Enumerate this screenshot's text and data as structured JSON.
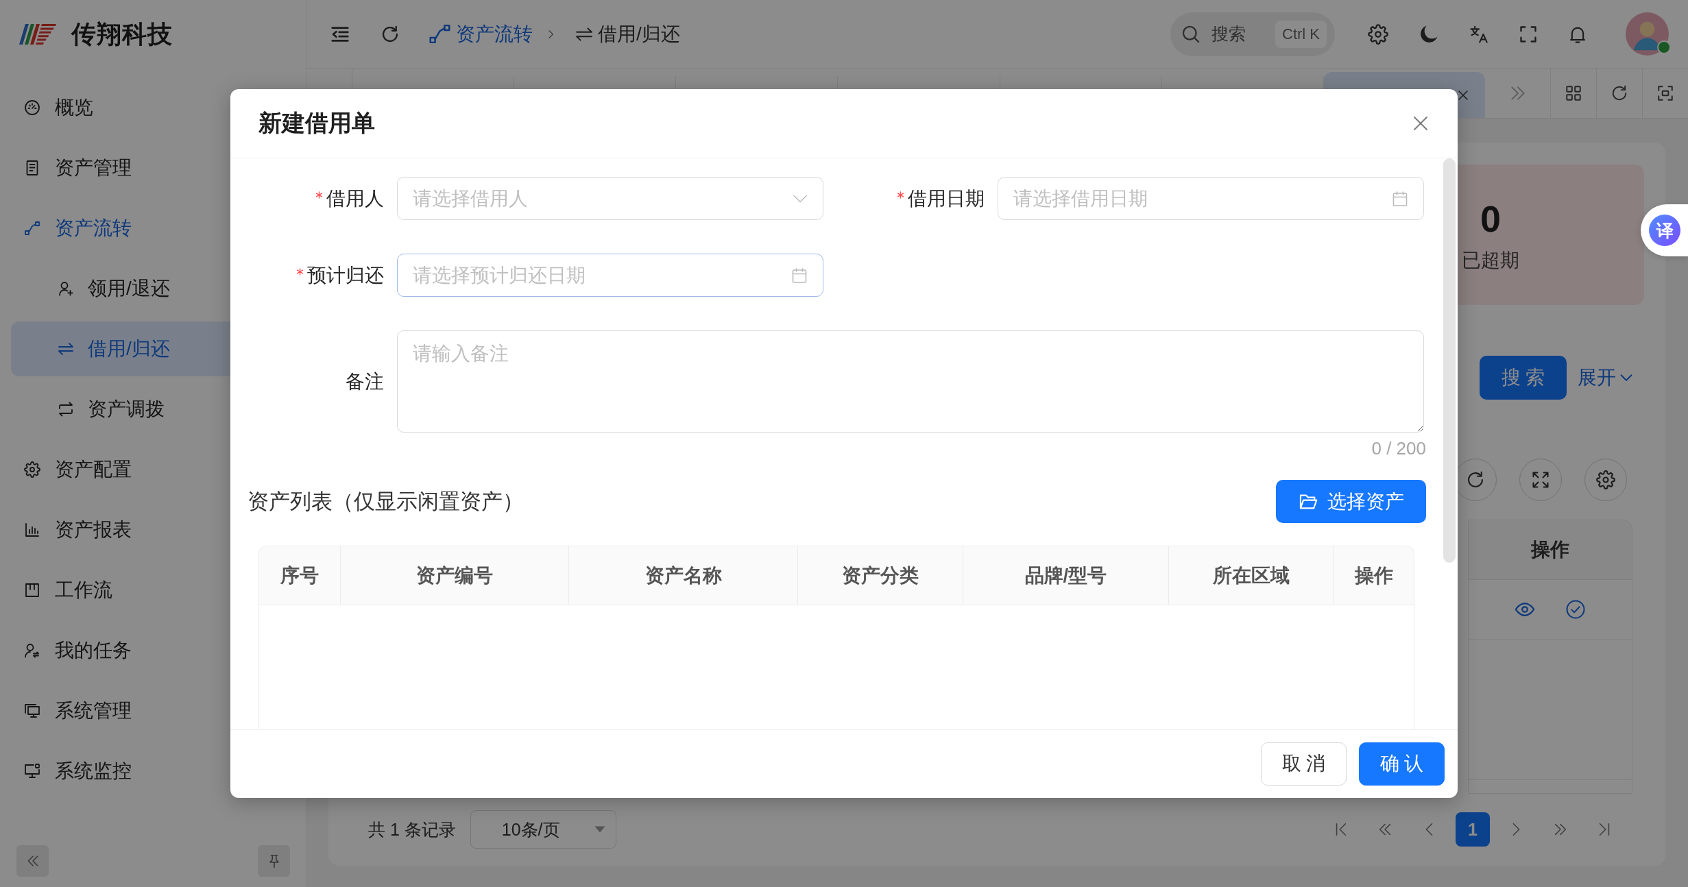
{
  "sidebar": {
    "brand": "传翔科技",
    "items": [
      {
        "label": "概览",
        "selected": false
      },
      {
        "label": "资产管理",
        "selected": false
      },
      {
        "label": "资产流转",
        "selected": false,
        "children": [
          {
            "label": "领用/退还",
            "selected": false
          },
          {
            "label": "借用/归还",
            "selected": true
          },
          {
            "label": "资产调拨",
            "selected": false
          }
        ]
      },
      {
        "label": "资产配置",
        "selected": false
      },
      {
        "label": "资产报表",
        "selected": false
      },
      {
        "label": "工作流",
        "selected": false
      },
      {
        "label": "我的任务",
        "selected": false
      },
      {
        "label": "系统管理",
        "selected": false
      },
      {
        "label": "系统监控",
        "selected": false
      }
    ]
  },
  "header": {
    "breadcrumb": [
      {
        "label": "资产流转"
      },
      {
        "label": "借用/归还"
      }
    ],
    "search": {
      "label": "搜索",
      "shortcut": "Ctrl K"
    },
    "user": {
      "online": true
    }
  },
  "tabs": [
    {
      "selected": false
    },
    {
      "selected": false
    },
    {
      "selected": false
    },
    {
      "selected": false
    },
    {
      "selected": false
    },
    {
      "selected": false
    },
    {
      "selected": true
    }
  ],
  "overview": {
    "stats": [
      {
        "value": "0",
        "label": "已超期"
      }
    ]
  },
  "query": {
    "search_button": "搜 索",
    "expand_link": "展开"
  },
  "records_table": {
    "columns": [
      "操作"
    ],
    "rows": [
      {
        "kind": "record"
      }
    ]
  },
  "pagination": {
    "total": "共 1 条记录",
    "page_size": "10条/页",
    "pages": [
      {
        "label": "1",
        "selected": true
      }
    ]
  },
  "dialog": {
    "title": "新建借用单",
    "fields": [
      {
        "kind": "select",
        "label": "借用人",
        "required": true,
        "placeholder": "请选择借用人",
        "focused": false
      },
      {
        "kind": "date",
        "label": "借用日期",
        "required": true,
        "placeholder": "请选择借用日期",
        "focused": false
      },
      {
        "kind": "date",
        "label": "预计归还",
        "required": true,
        "placeholder": "请选择预计归还日期",
        "focused": true
      },
      {
        "kind": "textarea",
        "label": "备注",
        "required": false,
        "placeholder": "请输入备注",
        "focused": false,
        "counter": "0 / 200"
      }
    ],
    "asset_section": {
      "title": "资产列表（仅显示闲置资产）",
      "select_button": "选择资产",
      "columns": [
        "序号",
        "资产编号",
        "资产名称",
        "资产分类",
        "品牌/型号",
        "所在区域",
        "操作"
      ]
    },
    "buttons": [
      {
        "label": "取 消",
        "kind": "default"
      },
      {
        "label": "确 认",
        "kind": "primary"
      }
    ]
  },
  "translate_bubble": {
    "label": "译"
  }
}
